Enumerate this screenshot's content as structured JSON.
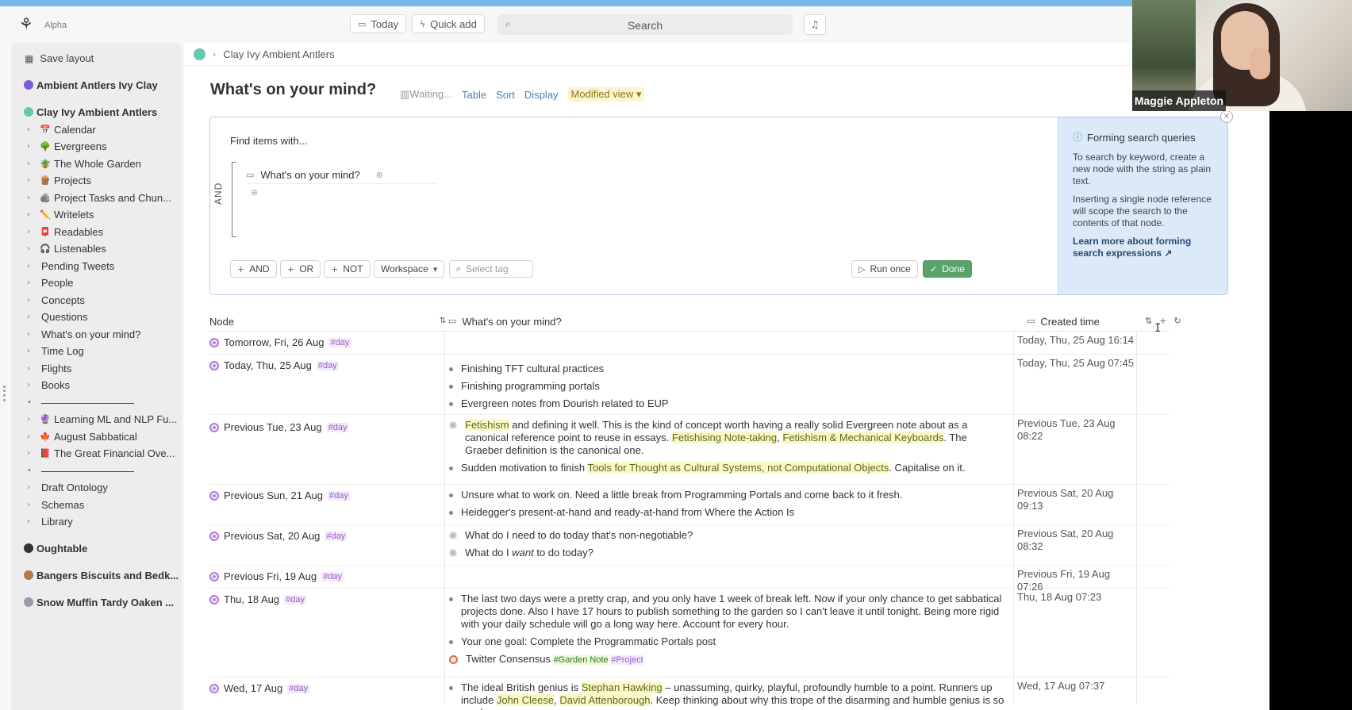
{
  "topbar": {
    "alpha_label": "Alpha",
    "today_label": "Today",
    "quick_add_label": "Quick add",
    "search_placeholder": "Search"
  },
  "sidebar": {
    "save_layout": "Save layout",
    "workspaces": [
      {
        "label": "Ambient Antlers Ivy Clay",
        "color": "#7a5bd6"
      },
      {
        "label": "Clay Ivy Ambient Antlers",
        "color": "#64c8b2"
      },
      {
        "label": "Oughtable",
        "color": "#333333"
      },
      {
        "label": "Bangers Biscuits and Bedk...",
        "color": "#b07a4a"
      },
      {
        "label": "Snow Muffin Tardy Oaken ...",
        "color": "#9a9aa6"
      }
    ],
    "items": [
      {
        "label": "Calendar",
        "emoji": "📅"
      },
      {
        "label": "Evergreens",
        "emoji": "🌳"
      },
      {
        "label": "The Whole Garden",
        "emoji": "🪴"
      },
      {
        "label": "Projects",
        "emoji": "🪵"
      },
      {
        "label": "Project Tasks and Chun...",
        "emoji": "🪨"
      },
      {
        "label": "Writelets",
        "emoji": "✏️"
      },
      {
        "label": "Readables",
        "emoji": "📮"
      },
      {
        "label": "Listenables",
        "emoji": "🎧"
      },
      {
        "label": "Pending Tweets",
        "emoji": ""
      },
      {
        "label": "People",
        "emoji": ""
      },
      {
        "label": "Concepts",
        "emoji": ""
      },
      {
        "label": "Questions",
        "emoji": ""
      },
      {
        "label": "What's on your mind?",
        "emoji": ""
      },
      {
        "label": "Time Log",
        "emoji": ""
      },
      {
        "label": "Flights",
        "emoji": ""
      },
      {
        "label": "Books",
        "emoji": ""
      },
      {
        "label": "—————————",
        "emoji": ""
      },
      {
        "label": "Learning ML and NLP Fu...",
        "emoji": "🔮"
      },
      {
        "label": "August Sabbatical",
        "emoji": "🍁"
      },
      {
        "label": "The Great Financial Ove...",
        "emoji": "📕"
      },
      {
        "label": "—————————",
        "emoji": ""
      },
      {
        "label": "Draft Ontology",
        "emoji": ""
      },
      {
        "label": "Schemas",
        "emoji": ""
      },
      {
        "label": "Library",
        "emoji": ""
      }
    ]
  },
  "main": {
    "breadcrumb": "Clay Ivy Ambient Antlers",
    "title": "What's on your mind?",
    "waiting": "Waiting...",
    "table_label": "Table",
    "sort_label": "Sort",
    "display_label": "Display",
    "modified_view": "Modified view"
  },
  "query": {
    "find_label": "Find items with...",
    "and_label": "AND",
    "condition": "What's on your mind?",
    "btn_and": "AND",
    "btn_or": "OR",
    "btn_not": "NOT",
    "btn_workspace": "Workspace",
    "select_tag_placeholder": "Select tag",
    "run_once": "Run once",
    "done": "Done",
    "info_title": "Forming search queries",
    "info_p1": "To search by keyword, create a new node with the string as plain text.",
    "info_p2": "Inserting a single node reference will scope the search to the contents of that node.",
    "info_link": "Learn more about forming search expressions"
  },
  "table": {
    "col_node": "Node",
    "col_mind": "What's on your mind?",
    "col_created": "Created time",
    "day_tag": "#day",
    "rows": [
      {
        "node": "Tomorrow, Fri, 26 Aug",
        "created": "Today, Thu, 25 Aug 16:14"
      },
      {
        "node": "Today, Thu, 25 Aug",
        "created": "Today, Thu, 25 Aug 07:45",
        "items": [
          "Finishing TFT cultural practices",
          "Finishing programming portals",
          "Evergreen notes from Dourish related to EUP"
        ]
      },
      {
        "node": "Previous Tue, 23 Aug",
        "created": "Previous Tue, 23 Aug 08:22",
        "ref1": "Fetishism",
        "text1": " and defining it well. This is the kind of concept worth having a really solid Evergreen note about as a canonical reference point to reuse in essays. ",
        "ref2": "Fetishising Note-taking",
        "ref3": "Fetishism & Mechanical Keyboards",
        "text2": ". The Graeber definition is the canonical one.",
        "text3": "Sudden motivation to finish ",
        "ref4": "Tools for Thought as Cultural Systems, not Computational Objects",
        "text4": ". Capitalise on it."
      },
      {
        "node": "Previous Sun, 21 Aug",
        "created": "Previous Sat, 20 Aug 09:13",
        "items": [
          "Unsure what to work on. Need a little break from Programming Portals and come back to it fresh.",
          "Heidegger's present-at-hand and ready-at-hand from Where the Action Is"
        ]
      },
      {
        "node": "Previous Sat, 20 Aug",
        "created": "Previous Sat, 20 Aug 08:32",
        "q1": "What do I need to do today that's non-negotiable?",
        "q2a": "What do I ",
        "q2b": "want",
        "q2c": " to do today?"
      },
      {
        "node": "Previous Fri, 19 Aug",
        "created": "Previous Fri, 19 Aug 07:26"
      },
      {
        "node": "Thu, 18 Aug",
        "created": "Thu, 18 Aug 07:23",
        "p1": "The last two days were a pretty crap, and you only have 1 week of break left. Now if your only chance to get sabbatical projects done. Also I have 17 hours to publish something to the garden so I can't leave it until tonight. Being more rigid with your daily schedule will go a long way here. Account for every hour.",
        "p2": "Your one goal: Complete the Programmatic Portals post",
        "p3": "Twitter Consensus",
        "tag_garden": "#Garden Note",
        "tag_project": "#Project"
      },
      {
        "node": "Wed, 17 Aug",
        "created": "Wed, 17 Aug 07:37",
        "w1": "The ideal British genius is ",
        "wref1": "Stephan Hawking",
        "w2": " – unassuming, quirky, playful, profoundly humble to a point. Runners up include ",
        "wref2": "John Cleese",
        "wref3": "David Attenborough",
        "w3": ". Keep thinking about why this trope of the disarming and humble genius is so much more"
      }
    ]
  },
  "webcam": {
    "name": "Maggie Appleton"
  }
}
